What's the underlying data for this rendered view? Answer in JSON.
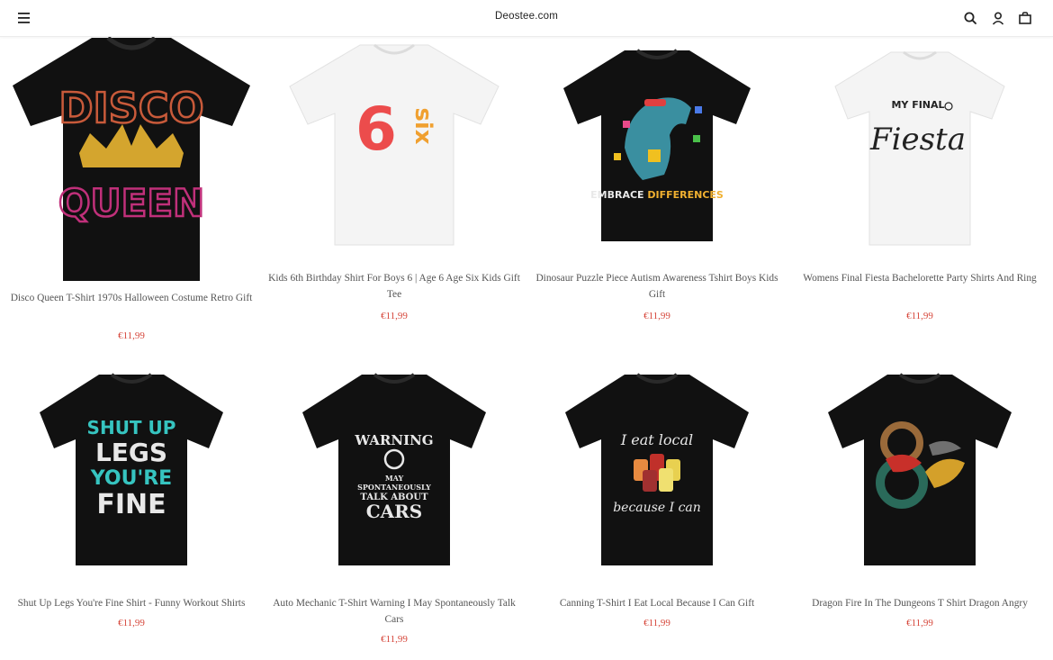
{
  "header": {
    "brand": "Deostee.com",
    "icons": [
      "menu-icon",
      "search-icon",
      "account-icon",
      "bag-icon"
    ]
  },
  "products": [
    {
      "title": "Disco Queen T-Shirt 1970s Halloween Costume Retro Gift",
      "price": "€11,99",
      "shirt_color": "#111111",
      "art": [
        "DISCO",
        "QUEEN"
      ]
    },
    {
      "title": "Kids 6th Birthday Shirt For Boys 6 | Age 6 Age Six Kids Gift Tee",
      "price": "€11,99",
      "shirt_color": "#f7f7f7",
      "art": [
        "6",
        "six"
      ]
    },
    {
      "title": "Dinosaur Puzzle Piece Autism Awareness Tshirt Boys Kids Gift",
      "price": "€11,99",
      "shirt_color": "#111111",
      "art": [
        "EMBRACE DIFFERENCES"
      ]
    },
    {
      "title": "Womens Final Fiesta Bachelorette Party Shirts And Ring",
      "price": "€11,99",
      "shirt_color": "#f7f7f7",
      "art": [
        "MY FINAL",
        "Fiesta"
      ]
    },
    {
      "title": "Shut Up Legs You're Fine Shirt - Funny Workout Shirts",
      "price": "€11,99",
      "shirt_color": "#111111",
      "art": [
        "SHUT UP",
        "LEGS",
        "YOU'RE",
        "FINE"
      ]
    },
    {
      "title": "Auto Mechanic T-Shirt Warning I May Spontaneously Talk Cars",
      "price": "€11,99",
      "shirt_color": "#111111",
      "art": [
        "WARNING",
        "MAY",
        "SPONTANEOUSLY",
        "TALK ABOUT",
        "CARS"
      ]
    },
    {
      "title": "Canning T-Shirt I Eat Local Because I Can Gift",
      "price": "€11,99",
      "shirt_color": "#111111",
      "art": [
        "I eat local",
        "because I can"
      ]
    },
    {
      "title": "Dragon Fire In The Dungeons T Shirt Dragon Angry",
      "price": "€11,99",
      "shirt_color": "#111111",
      "art": []
    }
  ]
}
